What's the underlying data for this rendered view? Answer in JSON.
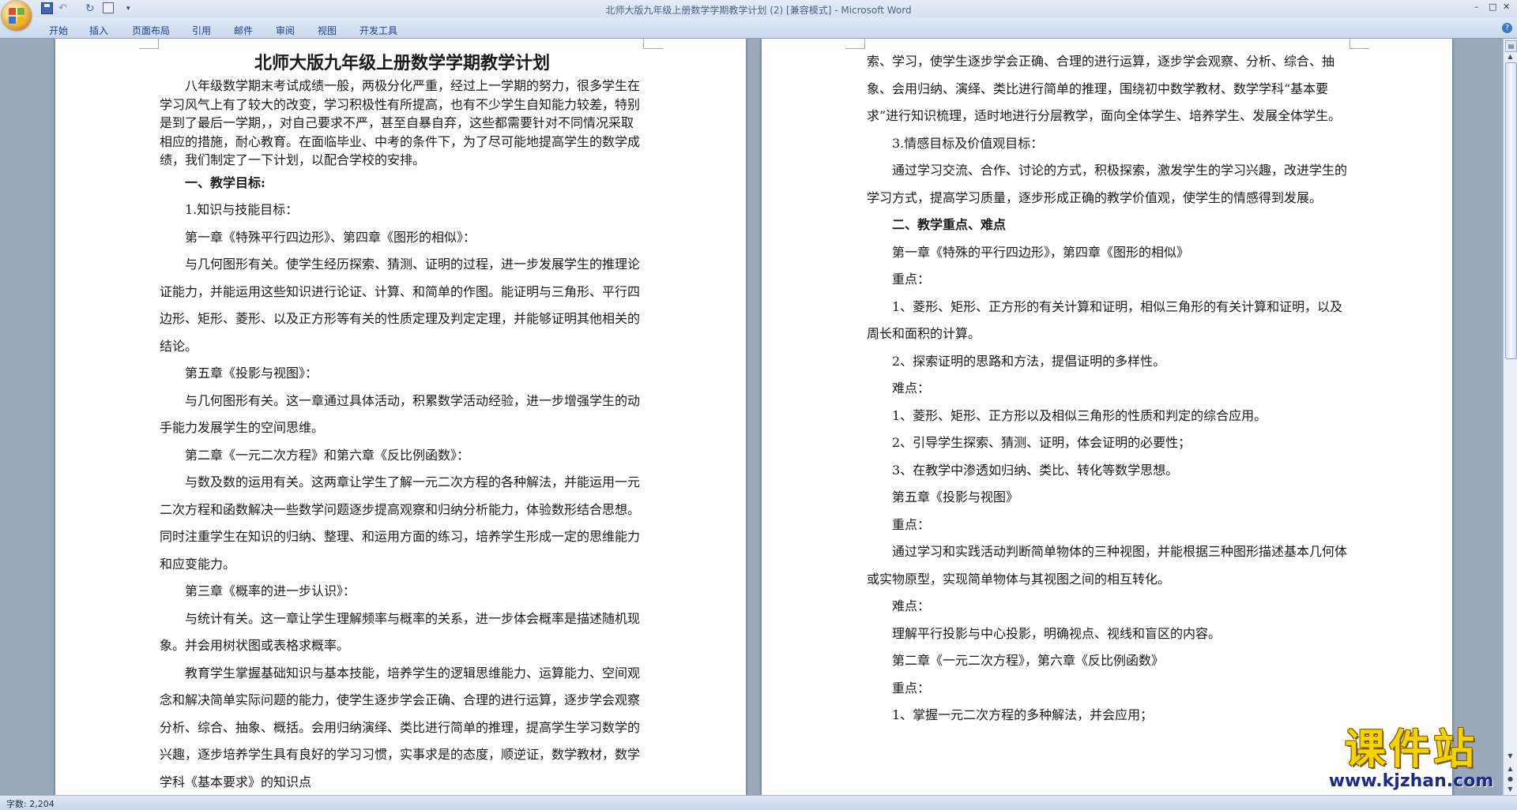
{
  "window": {
    "title": "北师大版九年级上册数学学期教学计划 (2) [兼容模式] - Microsoft Word",
    "controls": [
      "–",
      "□",
      "✕"
    ]
  },
  "quick_access": {
    "icons": [
      "save-icon",
      "undo-icon",
      "redo-icon",
      "print-preview-icon",
      "customize-icon"
    ]
  },
  "ribbon": {
    "tabs": [
      "开始",
      "插入",
      "页面布局",
      "引用",
      "邮件",
      "审阅",
      "视图",
      "开发工具"
    ]
  },
  "document": {
    "left_page": {
      "title": "北师大版九年级上册数学学期教学计划",
      "intro": "八年级数学期末考试成绩一般，两极分化严重，经过上一学期的努力，很多学生在学习风气上有了较大的改变，学习积极性有所提高，也有不少学生自知能力较差，特别是到了最后一学期，，对自己要求不严，甚至自暴自弃，这些都需要针对不同情况采取相应的措施，耐心教育。在面临毕业、中考的条件下，为了尽可能地提高学生的数学成绩，我们制定了一下计划，以配合学校的安排。",
      "paragraphs": [
        {
          "text": "一、教学目标:",
          "heading": true
        },
        {
          "text": "1.知识与技能目标：",
          "heading": false
        },
        {
          "text": "第一章《特殊平行四边形》、第四章《图形的相似》：",
          "heading": false
        },
        {
          "text": "与几何图形有关。使学生经历探索、猜测、证明的过程，进一步发展学生的推理论证能力，并能运用这些知识进行论证、计算、和简单的作图。能证明与三角形、平行四边形、矩形、菱形、以及正方形等有关的性质定理及判定定理，并能够证明其他相关的结论。",
          "heading": false
        },
        {
          "text": "第五章《投影与视图》：",
          "heading": false
        },
        {
          "text": "与几何图形有关。这一章通过具体活动，积累数学活动经验，进一步增强学生的动手能力发展学生的空间思维。",
          "heading": false
        },
        {
          "text": "第二章《一元二次方程》和第六章《反比例函数》：",
          "heading": false
        },
        {
          "text": "与数及数的运用有关。这两章让学生了解一元二次方程的各种解法，并能运用一元二次方程和函数解决一些数学问题逐步提高观察和归纳分析能力，体验数形结合思想。同时注重学生在知识的归纳、整理、和运用方面的练习，培养学生形成一定的思维能力和应变能力。",
          "heading": false
        },
        {
          "text": "第三章《概率的进一步认识》：",
          "heading": false
        },
        {
          "text": "与统计有关。这一章让学生理解频率与概率的关系，进一步体会概率是描述随机现象。并会用树状图或表格求概率。",
          "heading": false
        },
        {
          "text": "教育学生掌握基础知识与基本技能，培养学生的逻辑思维能力、运算能力、空间观念和解决简单实际问题的能力，使学生逐步学会正确、合理的进行运算，逐步学会观察分析、综合、抽象、概括。会用归纳演绎、类比进行简单的推理，提高学生学习数学的兴趣，逐步培养学生具有良好的学习习惯，实事求是的态度，顺逆证，数学教材，数学学科《基本要求》的知识点",
          "heading": false
        }
      ]
    },
    "right_page": {
      "continuation": "索、学习，使学生逐步学会正确、合理的进行运算，逐步学会观察、分析、综合、抽象、会用归纳、演绎、类比进行简单的推理，围绕初中数学教材、数学学科“基本要求”进行知识梳理，适时地进行分层教学，面向全体学生、培养学生、发展全体学生。",
      "paragraphs": [
        {
          "text": "3.情感目标及价值观目标：",
          "heading": false
        },
        {
          "text": "通过学习交流、合作、讨论的方式，积极探索，激发学生的学习兴趣，改进学生的学习方式，提高学习质量，逐步形成正确的教学价值观，使学生的情感得到发展。",
          "heading": false
        },
        {
          "text": "二、教学重点、难点",
          "heading": true
        },
        {
          "text": "第一章《特殊的平行四边形》，第四章《图形的相似》",
          "heading": false
        },
        {
          "text": "重点：",
          "heading": false
        },
        {
          "text": "1、菱形、矩形、正方形的有关计算和证明，相似三角形的有关计算和证明，以及周长和面积的计算。",
          "heading": false
        },
        {
          "text": "2、探索证明的思路和方法，提倡证明的多样性。",
          "heading": false
        },
        {
          "text": "难点：",
          "heading": false
        },
        {
          "text": "1、菱形、矩形、正方形以及相似三角形的性质和判定的综合应用。",
          "heading": false
        },
        {
          "text": "2、引导学生探索、猜测、证明，体会证明的必要性；",
          "heading": false
        },
        {
          "text": "3、在教学中渗透如归纳、类比、转化等数学思想。",
          "heading": false
        },
        {
          "text": "第五章《投影与视图》",
          "heading": false
        },
        {
          "text": "重点：",
          "heading": false
        },
        {
          "text": "通过学习和实践活动判断简单物体的三种视图，并能根据三种图形描述基本几何体或实物原型，实现简单物体与其视图之间的相互转化。",
          "heading": false
        },
        {
          "text": "难点：",
          "heading": false
        },
        {
          "text": "理解平行投影与中心投影，明确视点、视线和盲区的内容。",
          "heading": false
        },
        {
          "text": "第二章《一元二次方程》，第六章《反比例函数》",
          "heading": false
        },
        {
          "text": "重点：",
          "heading": false
        },
        {
          "text": "1、掌握一元二次方程的多种解法，并会应用；",
          "heading": false
        }
      ]
    }
  },
  "status_bar": {
    "word_count": "字数: 2,204"
  },
  "watermark": {
    "text_cn": "课件站",
    "url": "www.kjzhan.com"
  }
}
